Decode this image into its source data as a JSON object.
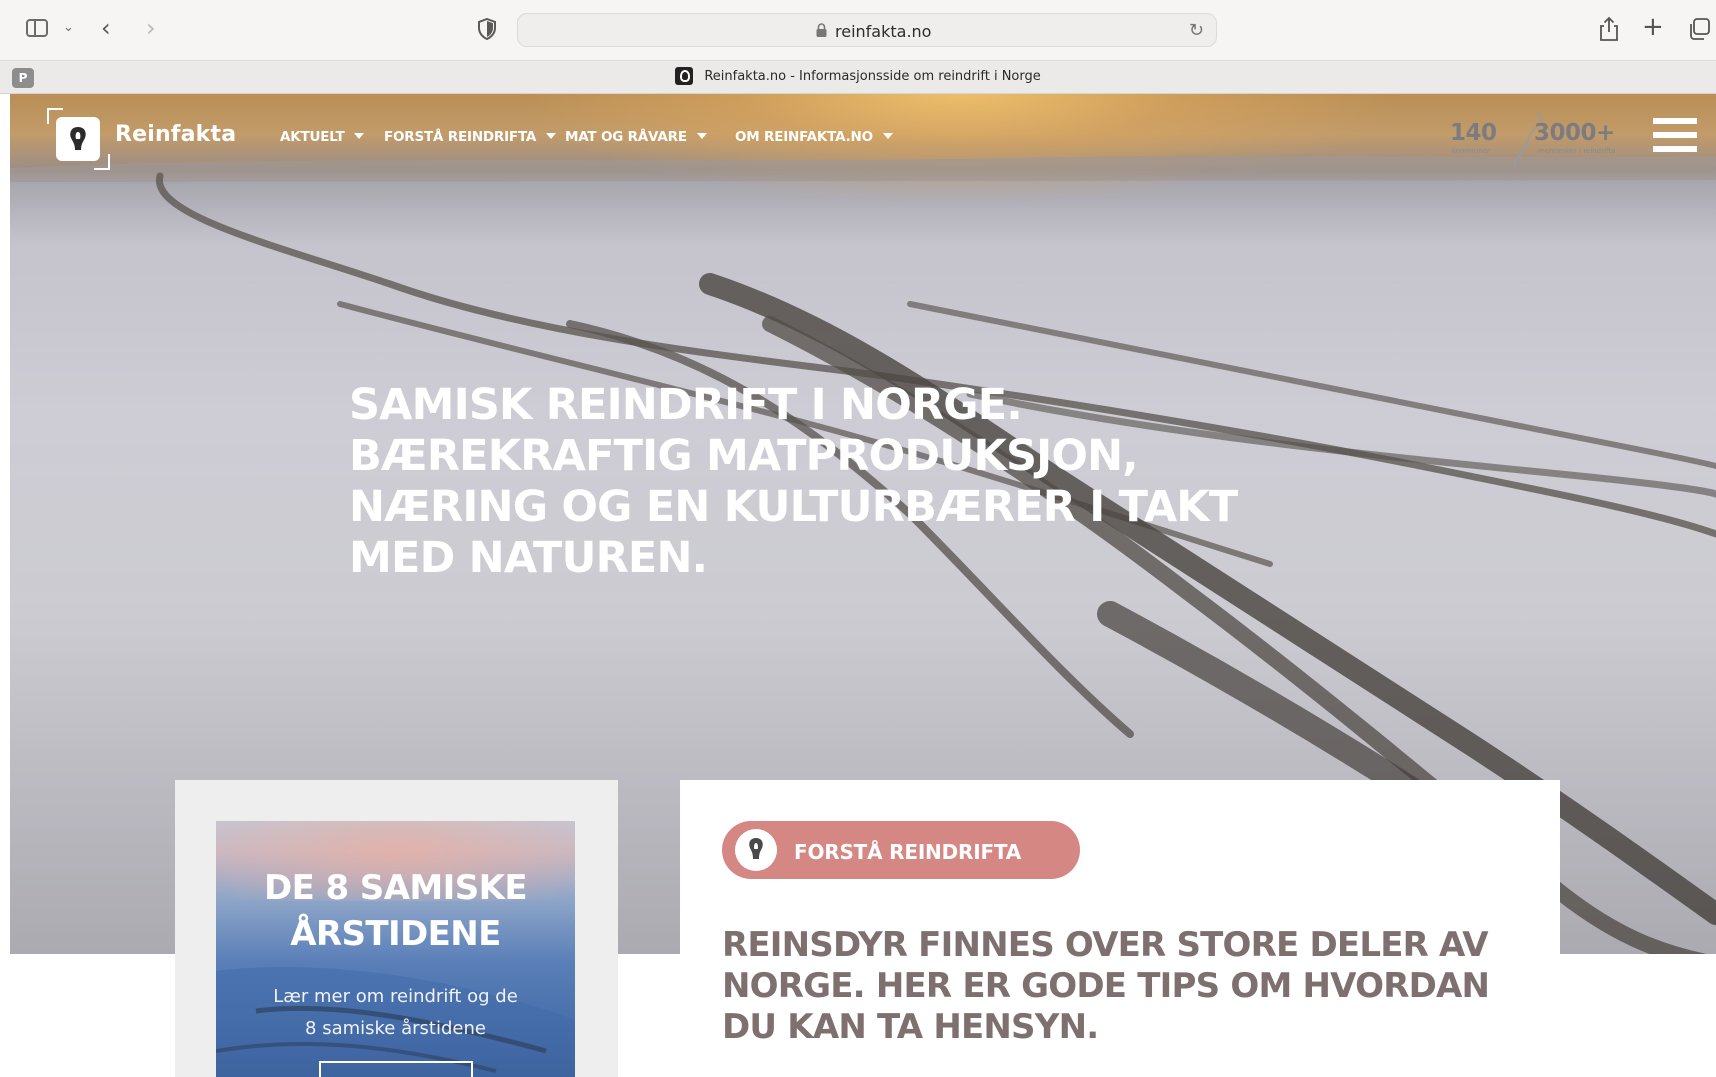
{
  "browser": {
    "url": "reinfakta.no",
    "tab_title": "Reinfakta.no - Informasjonsside om reindrift i Norge",
    "pinned_tab_letter": "P"
  },
  "site": {
    "logo_text": "Reinfakta",
    "nav": [
      {
        "label": "AKTUELT"
      },
      {
        "label": "FORSTÅ REINDRIFTA"
      },
      {
        "label": "MAT OG RÅVARE"
      },
      {
        "label": "OM REINFAKTA.NO"
      }
    ],
    "stats": [
      {
        "value": "140",
        "sub": "kommuner"
      },
      {
        "value": "3000+",
        "sub": "mennesker i reindrifta"
      }
    ]
  },
  "hero": {
    "lines": [
      "SAMISK REINDRIFT I NORGE.",
      "BÆREKRAFTIG MATPRODUKSJON,",
      "NÆRING OG EN KULTURBÆRER I TAKT",
      "MED NATUREN."
    ]
  },
  "promo": {
    "title_lines": [
      "DE 8 SAMISKE",
      "ÅRSTIDENE"
    ],
    "text_lines": [
      "Lær mer om reindrift og de",
      "8 samiske årstidene"
    ]
  },
  "info": {
    "category": "FORSTÅ REINDRIFTA",
    "heading_lines": [
      "REINSDYR FINNES OVER STORE DELER AV",
      "NORGE. HER ER GODE TIPS OM HVORDAN",
      "DU KAN TA HENSYN."
    ]
  },
  "colors": {
    "pill": "#d58783",
    "info_heading": "#7d706f",
    "promo_card_bg": "#eeeeee"
  },
  "icons": [
    "sidebar-icon",
    "chevron-down-icon",
    "back-icon",
    "forward-icon",
    "privacy-shield-icon",
    "lock-icon",
    "reload-icon",
    "share-icon",
    "new-tab-icon",
    "tab-overview-icon",
    "hamburger-menu-icon",
    "reinfakta-logo-icon"
  ]
}
